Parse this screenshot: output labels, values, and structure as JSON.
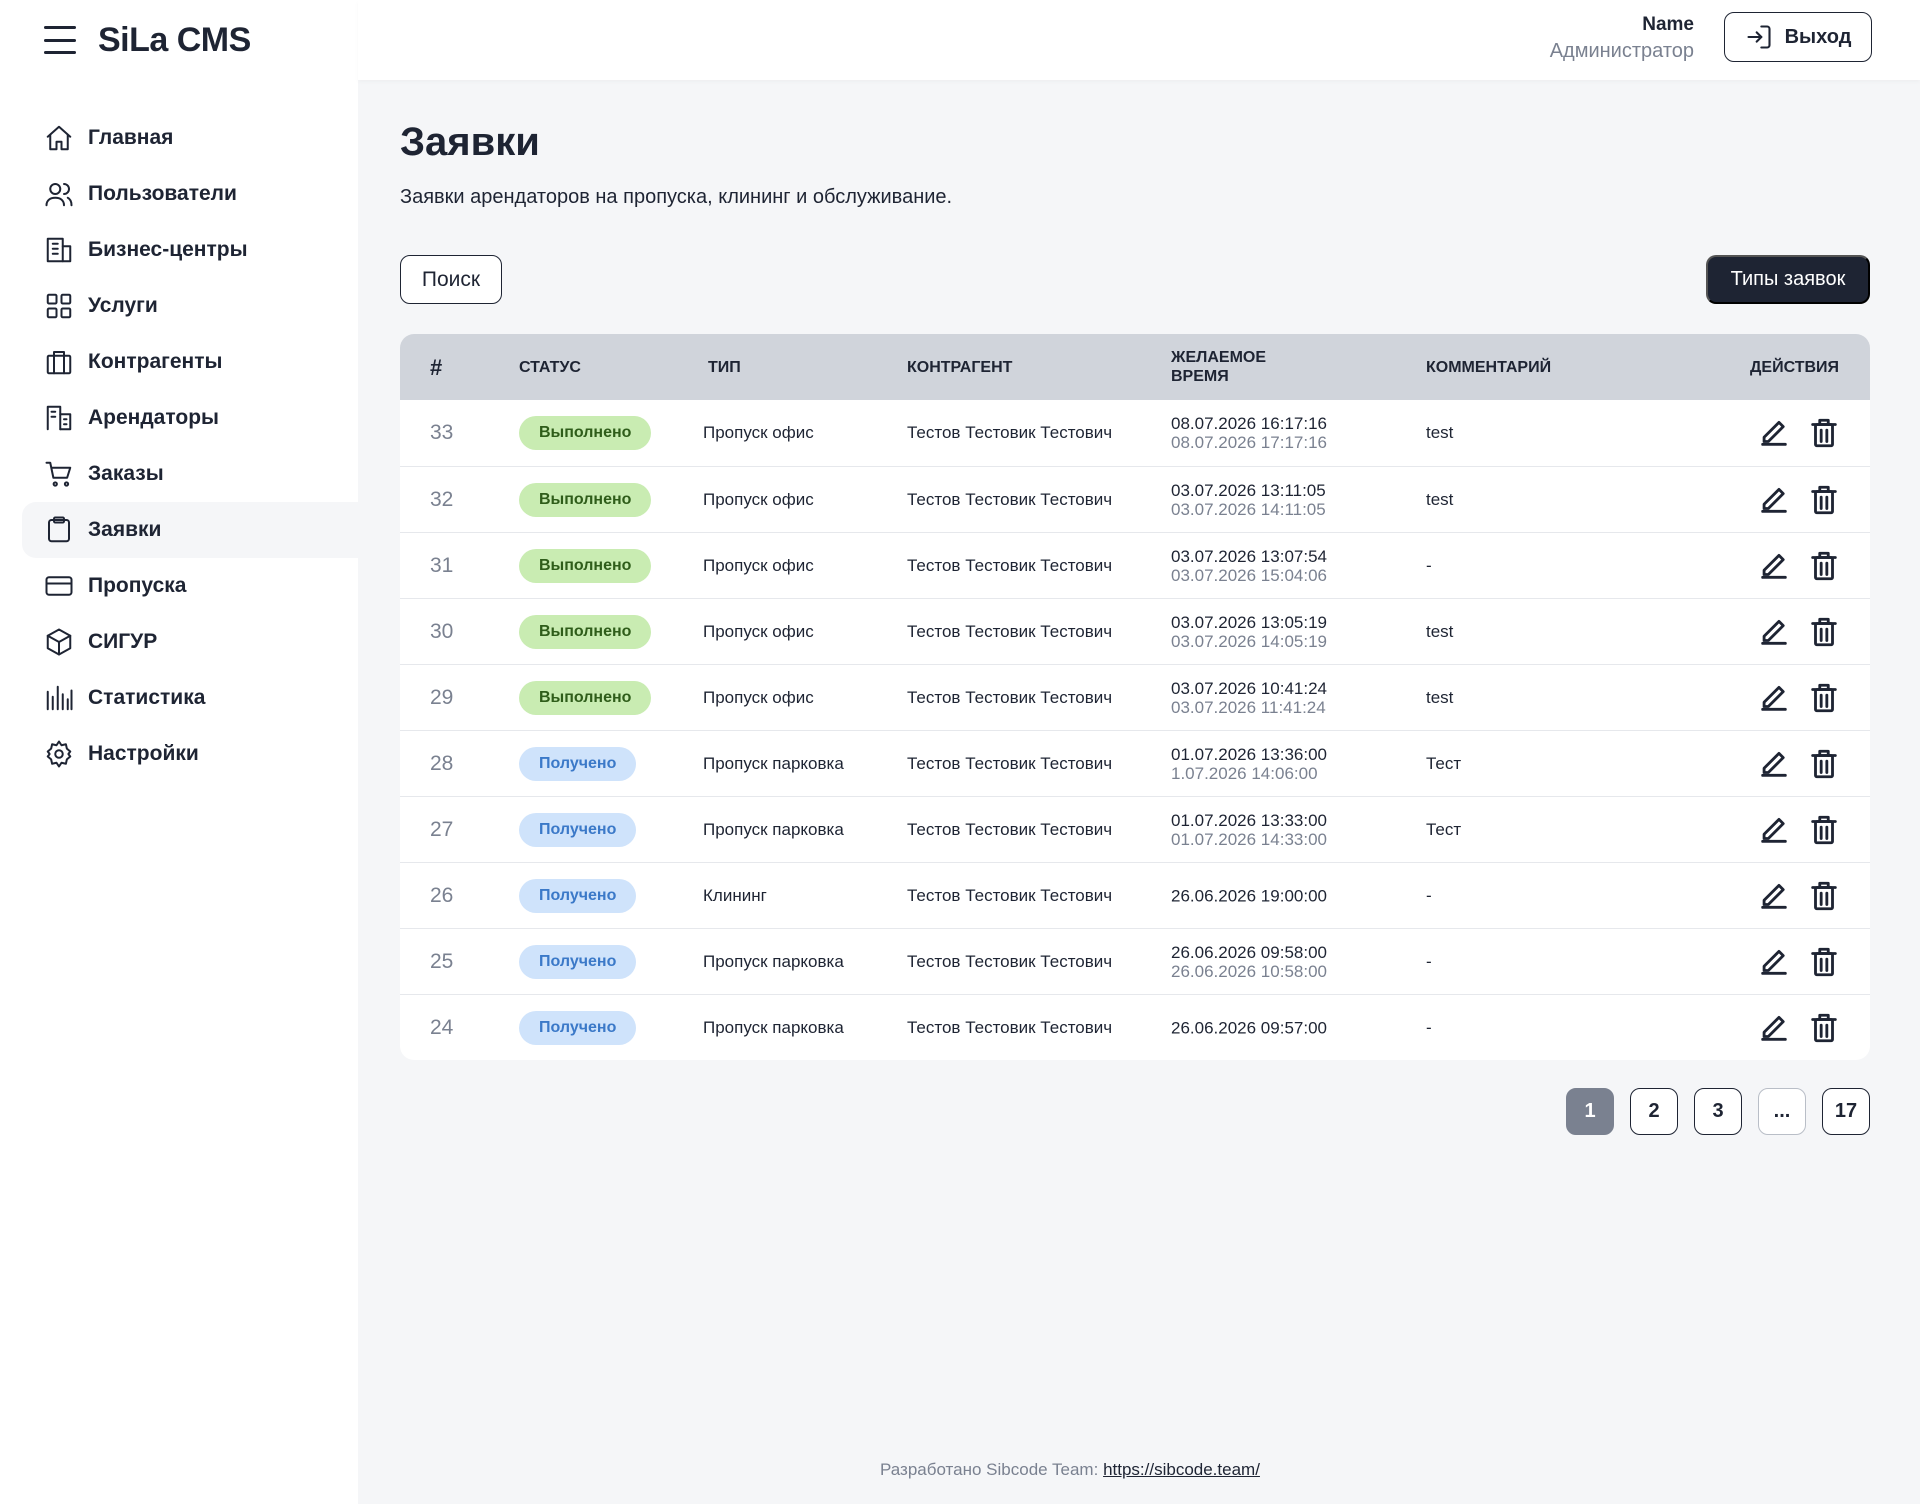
{
  "app": {
    "title": "SiLa CMS"
  },
  "sidebar": {
    "items": [
      {
        "label": "Главная",
        "icon": "home-icon",
        "active": false
      },
      {
        "label": "Пользователи",
        "icon": "users-icon",
        "active": false
      },
      {
        "label": "Бизнес-центры",
        "icon": "building-icon",
        "active": false
      },
      {
        "label": "Услуги",
        "icon": "grid-icon",
        "active": false
      },
      {
        "label": "Контрагенты",
        "icon": "briefcase-icon",
        "active": false
      },
      {
        "label": "Арендаторы",
        "icon": "office-icon",
        "active": false
      },
      {
        "label": "Заказы",
        "icon": "cart-icon",
        "active": false
      },
      {
        "label": "Заявки",
        "icon": "clipboard-icon",
        "active": true
      },
      {
        "label": "Пропуска",
        "icon": "card-icon",
        "active": false
      },
      {
        "label": "СИГУР",
        "icon": "cube-icon",
        "active": false
      },
      {
        "label": "Статистика",
        "icon": "stats-icon",
        "active": false
      },
      {
        "label": "Настройки",
        "icon": "gear-icon",
        "active": false
      }
    ]
  },
  "header": {
    "user_name": "Name",
    "user_role": "Администратор",
    "logout_label": "Выход"
  },
  "main": {
    "title": "Заявки",
    "subtitle": "Заявки арендаторов на пропуска, клининг и обслуживание.",
    "search_label": "Поиск",
    "types_label": "Типы заявок"
  },
  "table": {
    "columns": {
      "num": "#",
      "status": "Статус",
      "type": "Тип",
      "contractor": "Контрагент",
      "time_line1": "Желаемое",
      "time_line2": "время",
      "comment": "Комментарий",
      "actions": "Действия"
    },
    "rows": [
      {
        "id": "33",
        "status": "Выполнено",
        "status_kind": "done",
        "type": "Пропуск офис",
        "contractor": "Тестов Тестовик Тестович",
        "time_start": "08.07.2026 16:17:16",
        "time_end": "08.07.2026 17:17:16",
        "comment": "test"
      },
      {
        "id": "32",
        "status": "Выполнено",
        "status_kind": "done",
        "type": "Пропуск офис",
        "contractor": "Тестов Тестовик Тестович",
        "time_start": "03.07.2026 13:11:05",
        "time_end": "03.07.2026 14:11:05",
        "comment": "test"
      },
      {
        "id": "31",
        "status": "Выполнено",
        "status_kind": "done",
        "type": "Пропуск офис",
        "contractor": "Тестов Тестовик Тестович",
        "time_start": "03.07.2026 13:07:54",
        "time_end": "03.07.2026 15:04:06",
        "comment": "-"
      },
      {
        "id": "30",
        "status": "Выполнено",
        "status_kind": "done",
        "type": "Пропуск офис",
        "contractor": "Тестов Тестовик Тестович",
        "time_start": "03.07.2026 13:05:19",
        "time_end": "03.07.2026 14:05:19",
        "comment": "test"
      },
      {
        "id": "29",
        "status": "Выполнено",
        "status_kind": "done",
        "type": "Пропуск офис",
        "contractor": "Тестов Тестовик Тестович",
        "time_start": "03.07.2026 10:41:24",
        "time_end": "03.07.2026 11:41:24",
        "comment": "test"
      },
      {
        "id": "28",
        "status": "Получено",
        "status_kind": "received",
        "type": "Пропуск  парковка",
        "contractor": "Тестов Тестовик Тестович",
        "time_start": "01.07.2026 13:36:00",
        "time_end": "1.07.2026 14:06:00",
        "comment": "Тест"
      },
      {
        "id": "27",
        "status": "Получено",
        "status_kind": "received",
        "type": "Пропуск  парковка",
        "contractor": "Тестов Тестовик Тестович",
        "time_start": "01.07.2026 13:33:00",
        "time_end": "01.07.2026 14:33:00",
        "comment": "Тест"
      },
      {
        "id": "26",
        "status": "Получено",
        "status_kind": "received",
        "type": "Клининг",
        "contractor": "Тестов Тестовик Тестович",
        "time_start": "26.06.2026 19:00:00",
        "time_end": "",
        "comment": "-"
      },
      {
        "id": "25",
        "status": "Получено",
        "status_kind": "received",
        "type": "Пропуск  парковка",
        "contractor": "Тестов Тестовик Тестович",
        "time_start": "26.06.2026 09:58:00",
        "time_end": "26.06.2026 10:58:00",
        "comment": "-"
      },
      {
        "id": "24",
        "status": "Получено",
        "status_kind": "received",
        "type": "Пропуск  парковка",
        "contractor": "Тестов Тестовик Тестович",
        "time_start": "26.06.2026 09:57:00",
        "time_end": "",
        "comment": "-"
      }
    ]
  },
  "pagination": {
    "pages": [
      {
        "label": "1",
        "active": true
      },
      {
        "label": "2",
        "active": false
      },
      {
        "label": "3",
        "active": false
      },
      {
        "label": "...",
        "active": false
      },
      {
        "label": "17",
        "active": false
      }
    ]
  },
  "footer": {
    "text": "Разработано Sibcode Team:",
    "link": "https://sibcode.team/"
  },
  "colors": {
    "primary": "#1e2433",
    "done_bg": "#c9ecb2",
    "received_bg": "#cfe3fb",
    "muted": "#7a8190"
  }
}
